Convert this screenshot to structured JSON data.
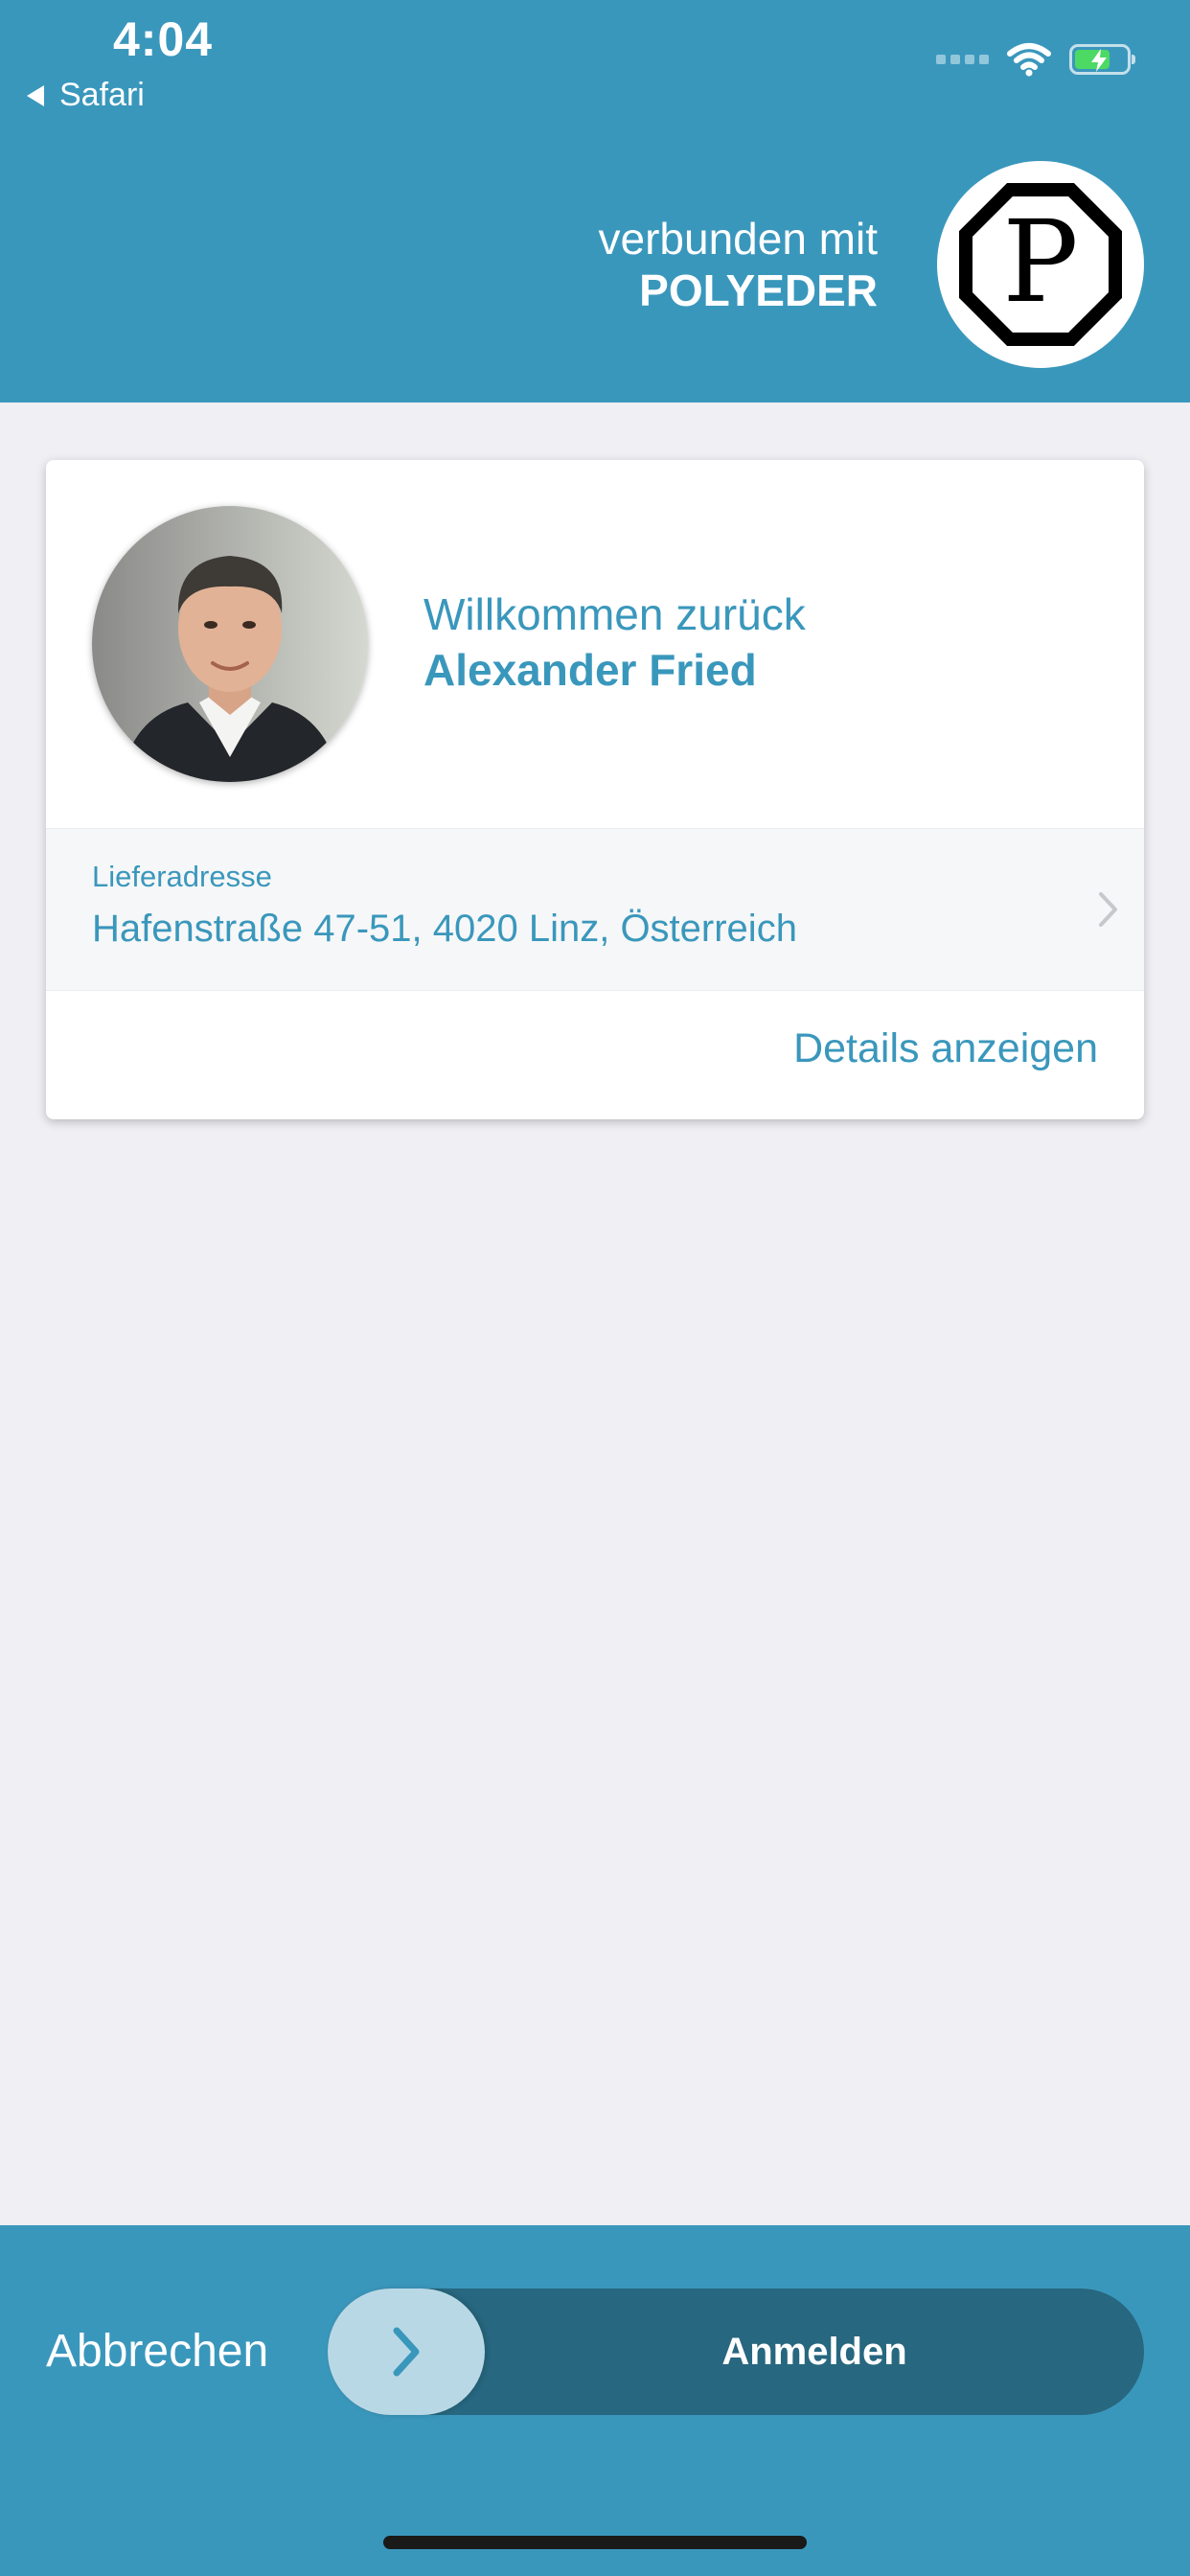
{
  "status_bar": {
    "time": "4:04",
    "back_label": "Safari"
  },
  "header": {
    "connected_label": "verbunden mit",
    "company_name": "POLYEDER",
    "logo_letter": "P"
  },
  "card": {
    "welcome_label": "Willkommen zurück",
    "user_name": "Alexander Fried",
    "address_label": "Lieferadresse",
    "address_value": "Hafenstraße 47-51, 4020 Linz, Österreich",
    "details_label": "Details anzeigen"
  },
  "actions": {
    "cancel_label": "Abbrechen",
    "slide_label": "Anmelden"
  },
  "colors": {
    "primary": "#3A97BC",
    "slider_track": "#27677F",
    "slider_handle": "#B9D8E5",
    "background": "#EFEFF4",
    "battery_charge": "#4CD964"
  },
  "icons": [
    "back-arrow-icon",
    "signal-icon",
    "wifi-icon",
    "battery-charging-icon",
    "polyeder-logo",
    "chevron-right-icon",
    "slider-chevron-icon"
  ]
}
